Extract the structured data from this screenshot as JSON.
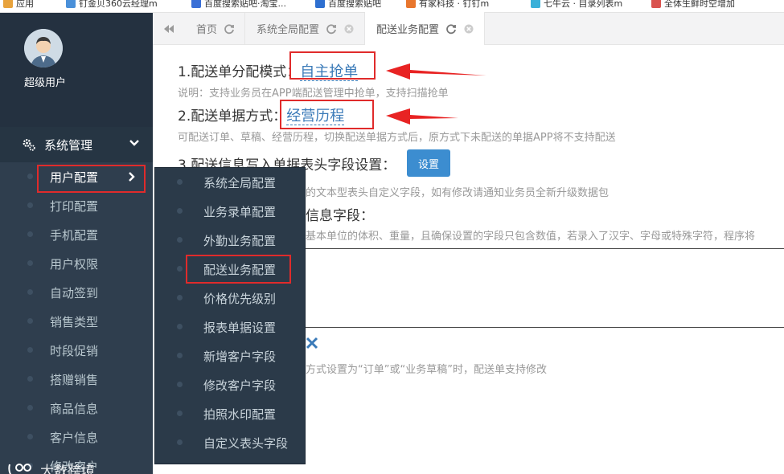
{
  "bookmarks": [
    {
      "label": "应用",
      "color": "#e8a33d"
    },
    {
      "label": "钉金贝360云经理m",
      "color": "#4a90d9"
    },
    {
      "label": "百度搜索贴吧·淘宝...",
      "color": "#3a6fd6"
    },
    {
      "label": "百度搜索贴吧",
      "color": "#2e6fd0"
    },
    {
      "label": "有家科技 · 钉钉m",
      "color": "#e8762d"
    },
    {
      "label": "七牛云 · 目录列表m",
      "color": "#3ab0d9"
    },
    {
      "label": "全体生鲜时空增加",
      "color": "#d9534f"
    }
  ],
  "sidebar": {
    "user_name": "超级用户",
    "menu_head": "系统管理",
    "items": [
      {
        "label": "用户配置"
      },
      {
        "label": "打印配置"
      },
      {
        "label": "手机配置"
      },
      {
        "label": "用户权限"
      },
      {
        "label": "自动签到"
      },
      {
        "label": "销售类型"
      },
      {
        "label": "时段促销"
      },
      {
        "label": "搭赠销售"
      },
      {
        "label": "商品信息"
      },
      {
        "label": "客户信息"
      },
      {
        "label": "修改客户"
      }
    ],
    "watermark": "大数跨境"
  },
  "flyout": {
    "items": [
      {
        "label": "系统全局配置"
      },
      {
        "label": "业务录单配置"
      },
      {
        "label": "外勤业务配置"
      },
      {
        "label": "配送业务配置"
      },
      {
        "label": "价格优先级别"
      },
      {
        "label": "报表单据设置"
      },
      {
        "label": "新增客户字段"
      },
      {
        "label": "修改客户字段"
      },
      {
        "label": "拍照水印配置"
      },
      {
        "label": "自定义表头字段"
      }
    ]
  },
  "tabs": [
    {
      "label": "首页"
    },
    {
      "label": "系统全局配置"
    },
    {
      "label": "配送业务配置"
    }
  ],
  "content": {
    "line1_label": "1.配送单分配模式：",
    "line1_value": "自主抢单",
    "note1": "说明：支持业务员在APP端配送管理中抢单，支持扫描抢单",
    "line2_label": "2.配送单据方式：",
    "line2_value": "经营历程",
    "note2": "可配送订单、草稿、经营历程，切换配送单据方式后，原方式下未配送的单据APP将不支持配送",
    "line3_label": "3.配送信息写入单据表头字段设置：",
    "set_button": "设置",
    "note3": "的文本型表头自定义字段，如有修改请通知业务员全新升级数据包",
    "line4_label": "信息字段：",
    "note4": "基本单位的体积、重量，且确保设置的字段只包含数值，若录入了汉字、字母或特殊字符，程序将",
    "note5": "方式设置为“订单”或“业务草稿”时，配送单支持修改"
  },
  "colors": {
    "sidebar_bg": "#2f3e4e",
    "annotation_red": "#e02b2b",
    "link_blue": "#3a7ab8",
    "button_blue": "#3c8dd0"
  }
}
